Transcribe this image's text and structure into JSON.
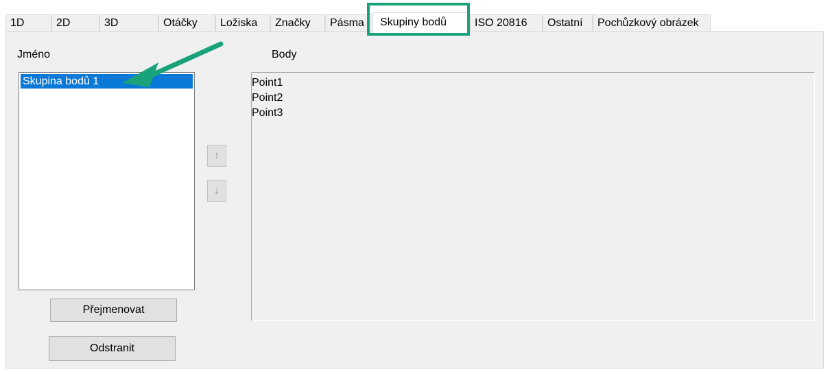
{
  "tabs": [
    {
      "label": "1D"
    },
    {
      "label": "2D"
    },
    {
      "label": "3D"
    },
    {
      "label": "Otáčky"
    },
    {
      "label": "Ložiska"
    },
    {
      "label": "Značky"
    },
    {
      "label": "Pásma"
    },
    {
      "label": "Skupiny bodů",
      "active": true
    },
    {
      "label": "ISO 20816"
    },
    {
      "label": "Ostatní"
    },
    {
      "label": "Pochůzkový obrázek"
    }
  ],
  "groups": {
    "label": "Jméno",
    "items": [
      "Skupina bodů 1"
    ],
    "selected_index": 0
  },
  "points": {
    "label": "Body",
    "items": [
      "Point1",
      "Point2",
      "Point3"
    ]
  },
  "move_buttons": {
    "up_glyph": "↑",
    "down_glyph": "↓"
  },
  "actions": {
    "rename_label": "Přejmenovat",
    "delete_label": "Odstranit"
  },
  "colors": {
    "selection": "#0a78d7",
    "annotation": "#1aa37a"
  }
}
